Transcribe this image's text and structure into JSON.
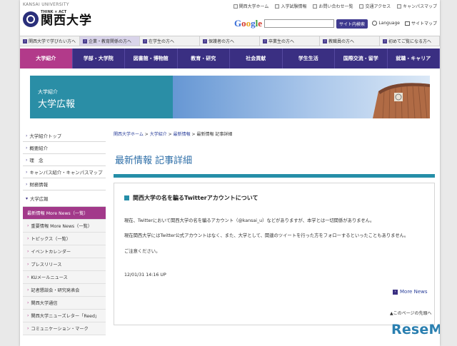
{
  "header": {
    "university_en": "KANSAI UNIVERSITY",
    "logo_tag": "THINK × ACT",
    "logo_name": "関西大学",
    "util_links": [
      "関西大学ホーム",
      "入学試験情報",
      "お問い合わせ一覧",
      "交通アクセス",
      "キャンパスマップ"
    ],
    "search_placeholder": "",
    "search_button": "サイト内検索",
    "language_label": "Language",
    "sitemap_label": "サイトマップ"
  },
  "audience_tabs": [
    {
      "label": "関西大学で学びたい方へ",
      "active": false
    },
    {
      "label": "企業・教育関係の方へ",
      "active": true
    },
    {
      "label": "在学生の方へ",
      "active": false
    },
    {
      "label": "保護者の方へ",
      "active": false
    },
    {
      "label": "卒業生の方へ",
      "active": false
    },
    {
      "label": "教職員の方へ",
      "active": false
    },
    {
      "label": "初めてご覧になる方へ",
      "active": false
    }
  ],
  "main_nav": [
    {
      "label": "大学紹介",
      "active": true
    },
    {
      "label": "学部・大学院",
      "active": false
    },
    {
      "label": "図書館・博物館",
      "active": false
    },
    {
      "label": "教育・研究",
      "active": false
    },
    {
      "label": "社会貢献",
      "active": false
    },
    {
      "label": "学生生活",
      "active": false
    },
    {
      "label": "国際交流・留学",
      "active": false
    },
    {
      "label": "就職・キャリア",
      "active": false
    }
  ],
  "banner": {
    "small": "大学紹介",
    "big": "大学広報"
  },
  "breadcrumb": [
    {
      "label": "関西大学ホーム"
    },
    {
      "label": "大学紹介"
    },
    {
      "label": "最新情報"
    },
    {
      "label": "最新情報 記事詳細"
    }
  ],
  "sidebar": {
    "items": [
      "大学紹介トップ",
      "概要紹介",
      "理　念",
      "キャンパス紹介・キャンパスマップ",
      "財務情報"
    ],
    "section": "大学広報",
    "subitems": [
      {
        "label": "最新情報 More News（一覧）",
        "active": true
      },
      {
        "label": "重要情報 More News（一覧）",
        "active": false
      },
      {
        "label": "トピックス（一覧）",
        "active": false
      },
      {
        "label": "イベントカレンダー",
        "active": false
      },
      {
        "label": "プレスリリース",
        "active": false
      },
      {
        "label": "KUメールニュース",
        "active": false
      },
      {
        "label": "記者懇談会・研究発表会",
        "active": false
      },
      {
        "label": "関西大学通信",
        "active": false
      },
      {
        "label": "関西大学ニューズレター「Reed」",
        "active": false
      },
      {
        "label": "コミュニケーション・マーク",
        "active": false
      }
    ]
  },
  "main": {
    "title": "最新情報 記事詳細",
    "article_title": "関西大学の名を騙るTwitterアカウントについて",
    "p1": "現在、Twitterにおいて関西大学の名を騙るアカウント（@kansai_u）などがありますが、本学とは一切関係がありません。",
    "p2": "現在関西大学にはTwitter公式アカウントはなく、また、大学として、関連のツイートを行った方をフォローするといったこともありません。",
    "p3": "ご注意ください。",
    "date": "12/01/31 14:16 UP",
    "more_news": "More News",
    "page_top": "このページの先頭へ"
  },
  "watermark": "ReseMom",
  "colors": {
    "nav": "#3a2f82",
    "accent": "#b23a8a",
    "teal": "#258ea8",
    "link": "#2a3f9a"
  }
}
